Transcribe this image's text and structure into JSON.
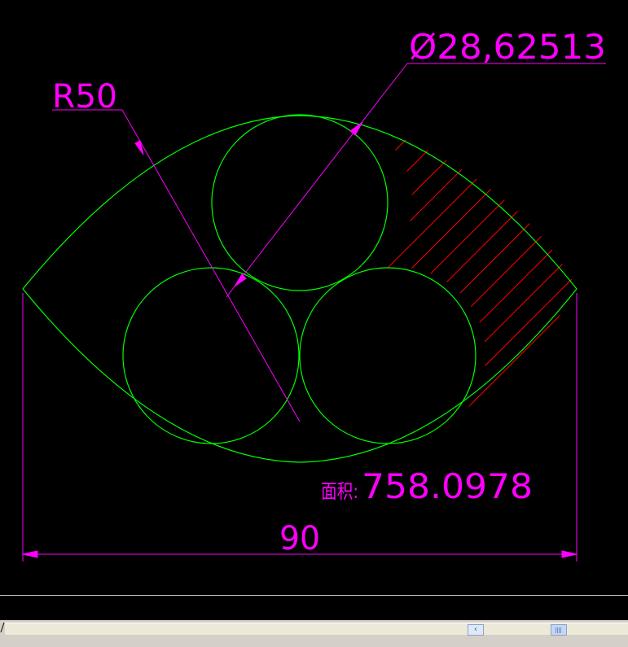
{
  "drawing": {
    "radius_label": "R50",
    "diameter_label": "Ø28,62513",
    "area_prefix": "面积:",
    "area_value": "758.0978",
    "width_label": "90"
  },
  "colors": {
    "geometry": "#00ff00",
    "dimension": "#ff00ff",
    "hatch": "#ff0000",
    "background": "#000000"
  },
  "scrollbar": {
    "left_arrow": "‹",
    "thumb_icon": "grip-icon"
  }
}
